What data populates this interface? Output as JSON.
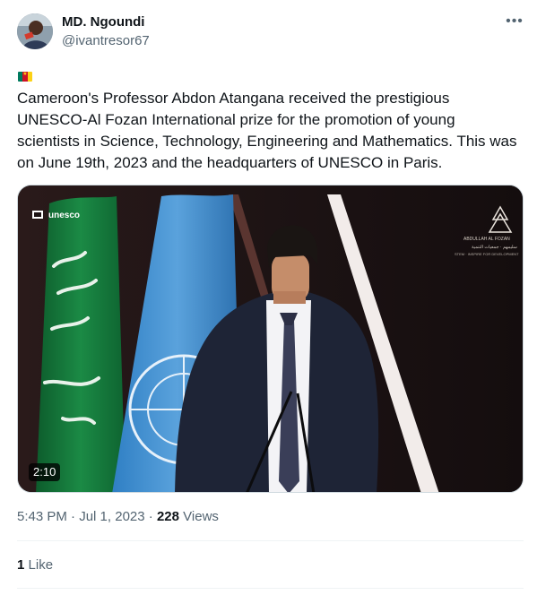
{
  "author": {
    "display_name": "MD. Ngoundi",
    "handle": "@ivantresor67"
  },
  "more_icon": "more-horizontal-icon",
  "flag": {
    "name": "cameroon-flag",
    "colors": [
      "#007a5e",
      "#ce1126",
      "#fcd116"
    ]
  },
  "tweet": {
    "text": "Cameroon's Professor Abdon Atangana received the prestigious UNESCO-Al Fozan International prize for the promotion of young scientists in Science, Technology, Engineering and Mathematics. This was on June 19th, 2023 and the headquarters of UNESCO in Paris."
  },
  "media": {
    "type": "video",
    "duration": "2:10",
    "overlay_left_logo": "unesco",
    "overlay_right_logo_line1": "ABDULLAH AL FOZAN",
    "overlay_right_logo_line2": "STEM · INSPIRE FOR DEVELOPMENT"
  },
  "meta": {
    "time": "5:43 PM",
    "separator": "·",
    "date": "Jul 1, 2023",
    "views_count": "228",
    "views_label": "Views"
  },
  "stats": {
    "likes_count": "1",
    "likes_label": "Like"
  }
}
